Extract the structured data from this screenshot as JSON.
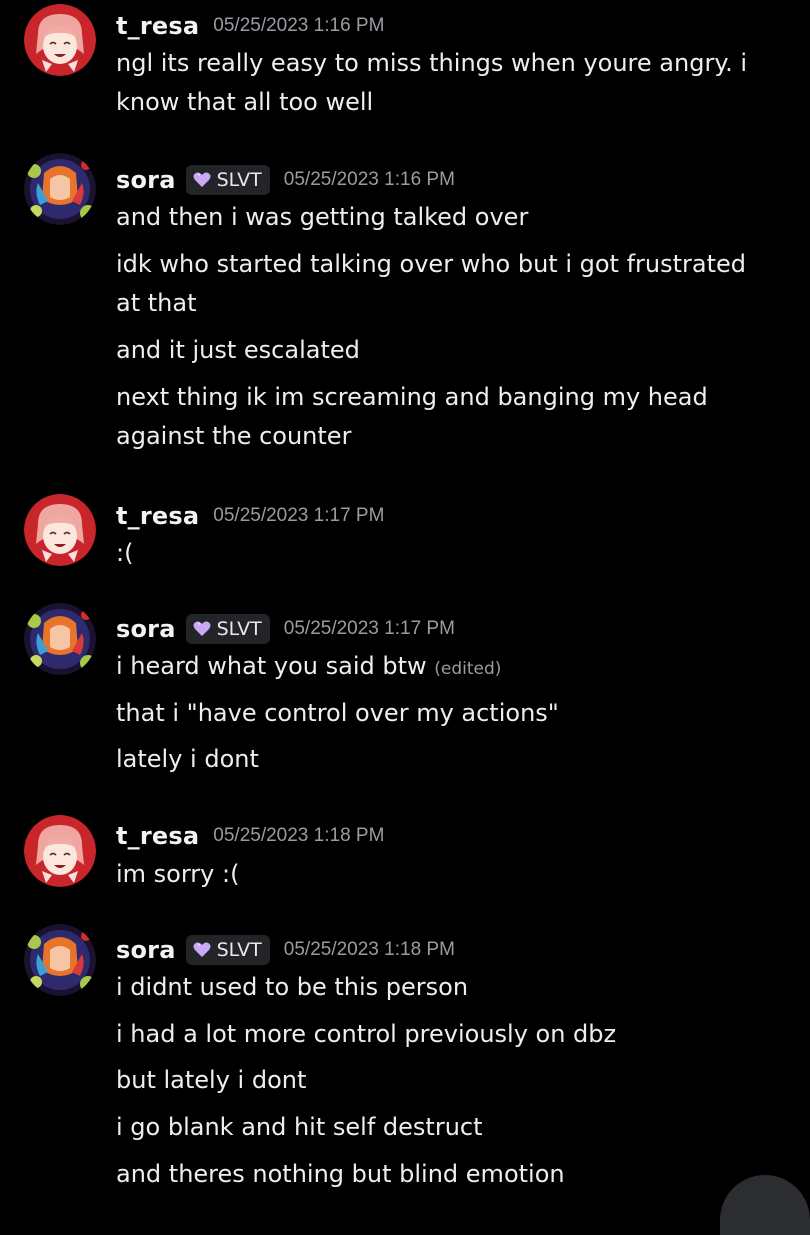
{
  "colors": {
    "background": "#000000",
    "text": "#eceef1",
    "timestamp": "#9a9ca3",
    "tag_bg": "#232428",
    "heart": "#c9a8f5"
  },
  "messages": [
    {
      "user": "t_resa",
      "timestamp": "05/25/2023 1:16 PM",
      "lines": [
        "ngl its really easy to miss things when youre angry. i",
        "know that all too well"
      ]
    },
    {
      "user": "sora",
      "tag": "SLVT",
      "tag_icon": "heart-icon",
      "timestamp": "05/25/2023 1:16 PM",
      "lines": [
        "and then i was getting talked over",
        "idk who started talking over who but i got frustrated",
        "at that",
        "and it just escalated",
        "next thing ik im screaming and banging my head",
        "against the counter"
      ]
    },
    {
      "user": "t_resa",
      "timestamp": "05/25/2023 1:17 PM",
      "lines": [
        ":("
      ]
    },
    {
      "user": "sora",
      "tag": "SLVT",
      "tag_icon": "heart-icon",
      "timestamp": "05/25/2023 1:17 PM",
      "lines": [
        "i heard what you said btw",
        "that i \"have control over my actions\"",
        "lately i dont"
      ],
      "edited_label": "(edited)"
    },
    {
      "user": "t_resa",
      "timestamp": "05/25/2023 1:18 PM",
      "lines": [
        "im sorry :("
      ]
    },
    {
      "user": "sora",
      "tag": "SLVT",
      "tag_icon": "heart-icon",
      "timestamp": "05/25/2023 1:18 PM",
      "lines": [
        "i didnt used to be this person",
        "i had a lot more control previously on dbz",
        "but lately i dont",
        "i go blank and hit self destruct",
        "and theres nothing but blind emotion"
      ]
    }
  ]
}
